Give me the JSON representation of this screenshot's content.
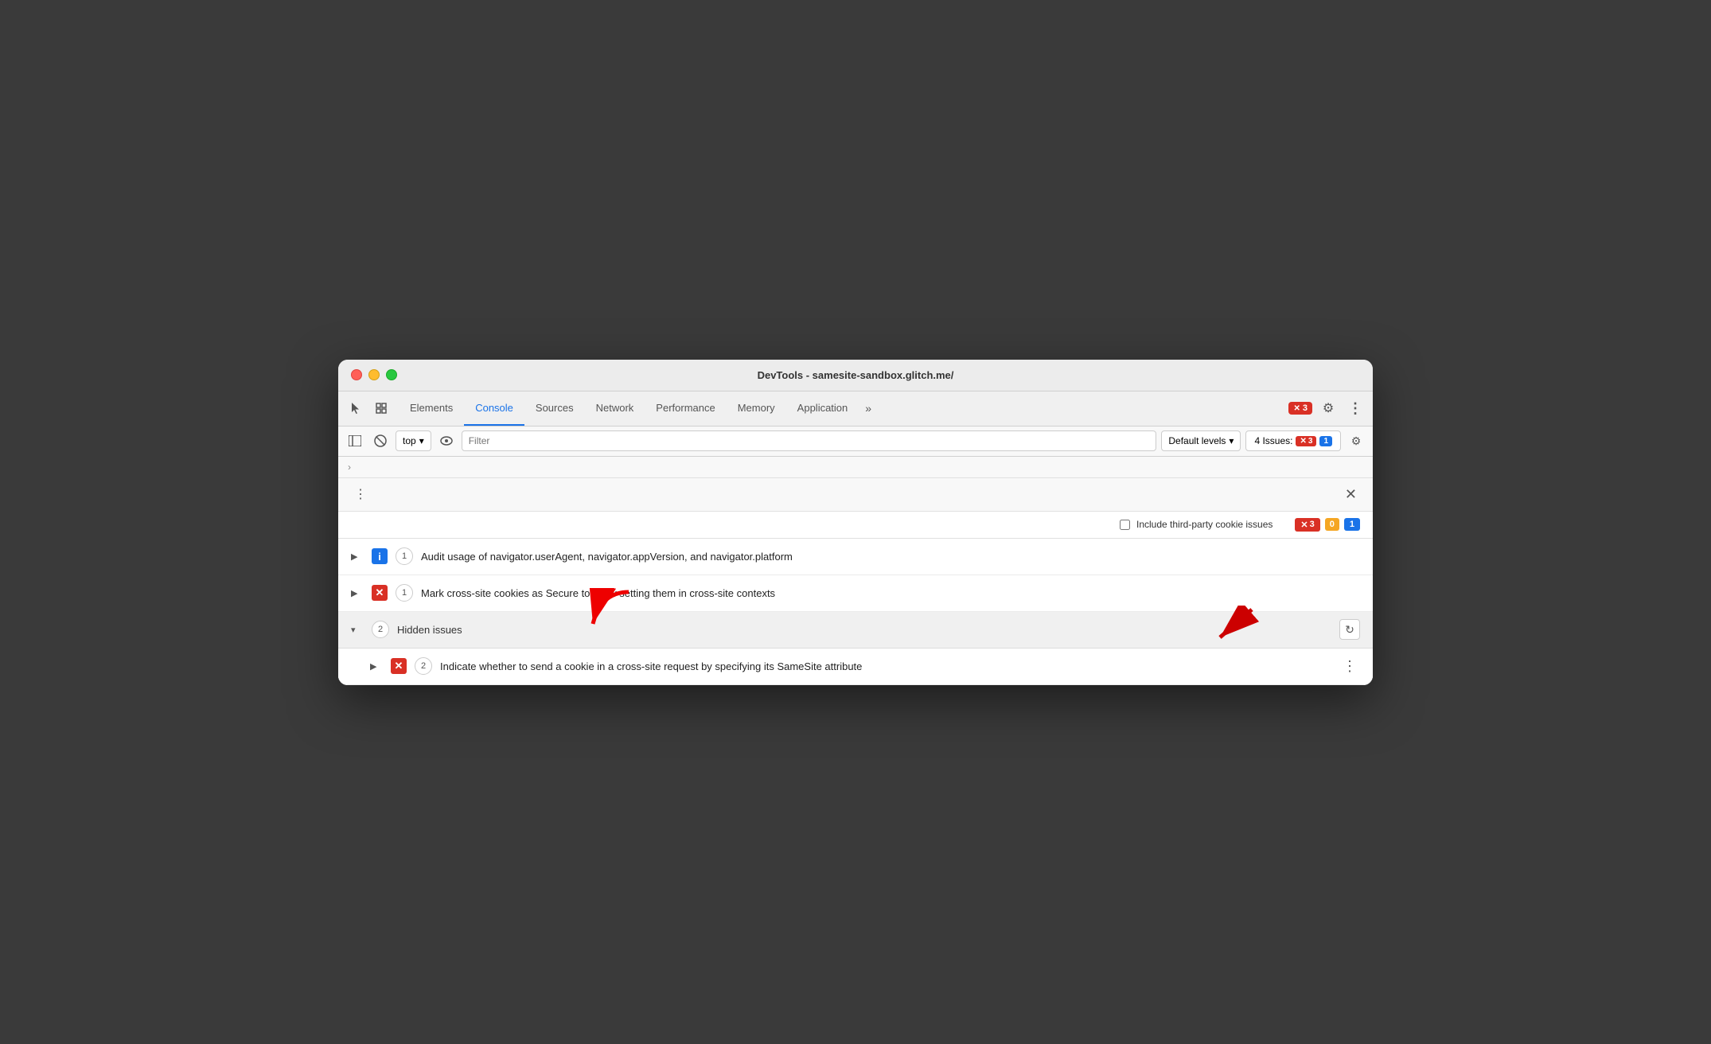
{
  "window": {
    "title": "DevTools - samesite-sandbox.glitch.me/"
  },
  "tabs": [
    {
      "id": "elements",
      "label": "Elements",
      "active": false
    },
    {
      "id": "console",
      "label": "Console",
      "active": true
    },
    {
      "id": "sources",
      "label": "Sources",
      "active": false
    },
    {
      "id": "network",
      "label": "Network",
      "active": false
    },
    {
      "id": "performance",
      "label": "Performance",
      "active": false
    },
    {
      "id": "memory",
      "label": "Memory",
      "active": false
    },
    {
      "id": "application",
      "label": "Application",
      "active": false
    }
  ],
  "toolbar": {
    "context_selector": "top",
    "filter_placeholder": "Filter",
    "levels_label": "Default levels",
    "issues_label": "4 Issues:",
    "issues_error_count": "3",
    "issues_info_count": "1"
  },
  "issues_panel": {
    "include_label": "Include third-party cookie issues",
    "error_count": "3",
    "warning_count": "0",
    "info_count": "1",
    "issues": [
      {
        "id": "issue-1",
        "icon": "blue",
        "count": "1",
        "text": "Audit usage of navigator.userAgent, navigator.appVersion, and navigator.platform",
        "expanded": false
      },
      {
        "id": "issue-2",
        "icon": "red",
        "count": "1",
        "text": "Mark cross-site cookies as Secure to allow setting them in cross-site contexts",
        "expanded": false
      }
    ],
    "hidden_issues": {
      "count": "2",
      "label": "Hidden issues",
      "sub_issues": [
        {
          "id": "hidden-1",
          "icon": "red",
          "count": "2",
          "text": "Indicate whether to send a cookie in a cross-site request by specifying its SameSite attribute",
          "expanded": false
        }
      ]
    }
  },
  "breadcrumb": {
    "arrow": "›"
  },
  "icons": {
    "cursor": "⬆",
    "layers": "⧉",
    "play": "▶",
    "block": "⊘",
    "eye": "◉",
    "chevron_down": "▾",
    "gear": "⚙",
    "more_vert": "⋮",
    "close": "✕",
    "refresh": "↻",
    "expand_right": "▶",
    "expand_down": "▾",
    "more_tabs": "»",
    "x_mark": "✕",
    "info": "ℹ",
    "warning": "⚠"
  },
  "error_badge": {
    "count": "3"
  }
}
